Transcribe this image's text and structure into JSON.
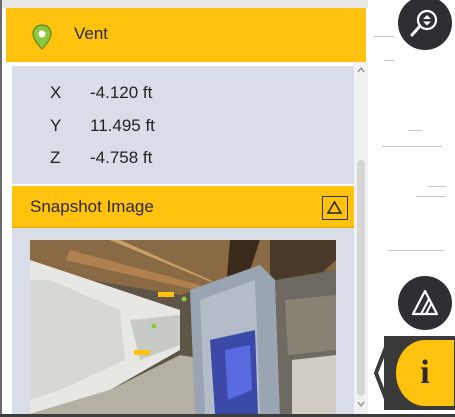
{
  "panel": {
    "title": "Vent",
    "coordinates": [
      {
        "axis": "X",
        "value": "-4.120 ft"
      },
      {
        "axis": "Y",
        "value": "11.495 ft"
      },
      {
        "axis": "Z",
        "value": "-4.758 ft"
      }
    ],
    "snapshot_label": "Snapshot Image"
  },
  "viewer": {
    "info_letter": "i"
  },
  "colors": {
    "accent": "#ffc20e",
    "panel_bg": "#d9dde7",
    "dark_button": "#2f2f33",
    "pin": "#8ec63f"
  },
  "icons": {
    "title_icon": "location-pin-icon",
    "collapse": "triangle-up-icon",
    "top_button": "navigate-icon",
    "mid_button": "measure-icon",
    "info": "info-icon",
    "arrow": "chevron-left-icon"
  }
}
